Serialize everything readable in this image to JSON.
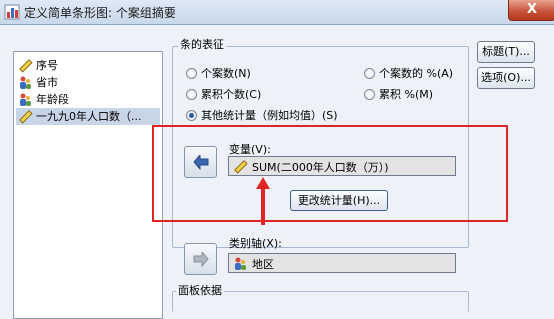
{
  "window": {
    "title": "定义简单条形图: 个案组摘要",
    "close_glyph": "X"
  },
  "variables": [
    {
      "label": "序号",
      "icon": "scale-ruler-icon"
    },
    {
      "label": "省市",
      "icon": "nominal-person-icon"
    },
    {
      "label": "年龄段",
      "icon": "nominal-person-icon"
    },
    {
      "label": "一九九0年人口数（...",
      "icon": "scale-ruler-icon",
      "selected": true
    }
  ],
  "bar_represent": {
    "title": "条的表征",
    "options": [
      {
        "label": "个案数(N)",
        "selected": false
      },
      {
        "label": "个案数的 %(A)",
        "selected": false
      },
      {
        "label": "累积个数(C)",
        "selected": false
      },
      {
        "label": "累积 %(M)",
        "selected": false
      },
      {
        "label": "其他统计量（例如均值）(S)",
        "selected": true
      }
    ],
    "variable_label": "变量(V):",
    "variable_value": "SUM(二000年人口数（万）)",
    "change_stat_button": "更改统计量(H)..."
  },
  "category_axis": {
    "label": "类别轴(X):",
    "value": "地区"
  },
  "panel_by": {
    "title": "面板依据"
  },
  "side_buttons": {
    "titles": "标题(T)...",
    "options": "选项(O)..."
  },
  "colors": {
    "annotation_red": "#e02424",
    "selection": "#c8d5e6",
    "arrow_blue": "#3a66b0"
  }
}
